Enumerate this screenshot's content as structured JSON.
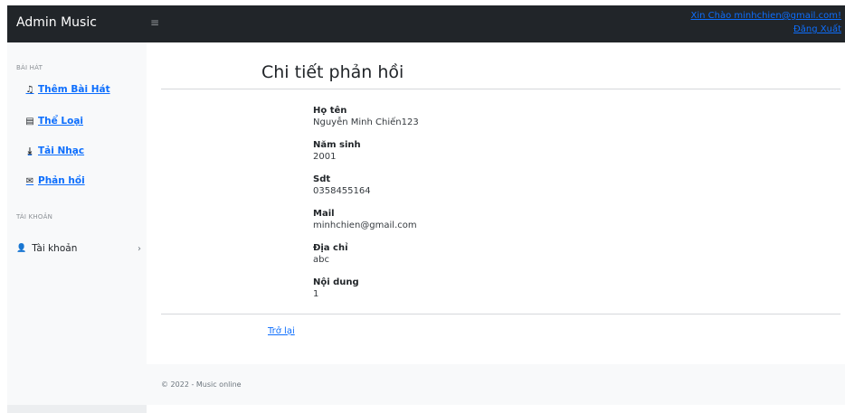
{
  "topbar": {
    "brand": "Admin Music",
    "toggle_icon": "≡",
    "greeting": "Xin Chào minhchien@gmail.com!",
    "logout": "Đăng Xuất"
  },
  "sidebar": {
    "heading_songs": "BÀI HÁT",
    "items": [
      {
        "label": "Thêm Bài Hát",
        "icon": "music-note-icon"
      },
      {
        "label": "Thể Loại",
        "icon": "list-icon"
      },
      {
        "label": "Tải Nhạc",
        "icon": "download-icon"
      },
      {
        "label": "Phản hồi",
        "icon": "envelope-icon"
      }
    ],
    "heading_account": "TÀI KHOẢN",
    "account_label": "Tài khoản",
    "account_icon": "user-icon"
  },
  "main": {
    "title": "Chi tiết phản hồi",
    "fields": [
      {
        "label": "Họ tên",
        "value": "Nguyễn Minh Chiến123"
      },
      {
        "label": "Năm sinh",
        "value": "2001"
      },
      {
        "label": "Sdt",
        "value": "0358455164"
      },
      {
        "label": "Mail",
        "value": "minhchien@gmail.com"
      },
      {
        "label": "Địa chỉ",
        "value": "abc"
      },
      {
        "label": "Nội dung",
        "value": "1"
      }
    ],
    "back_link": "Trở lại"
  },
  "footer": {
    "text": "© 2022 - Music online"
  }
}
